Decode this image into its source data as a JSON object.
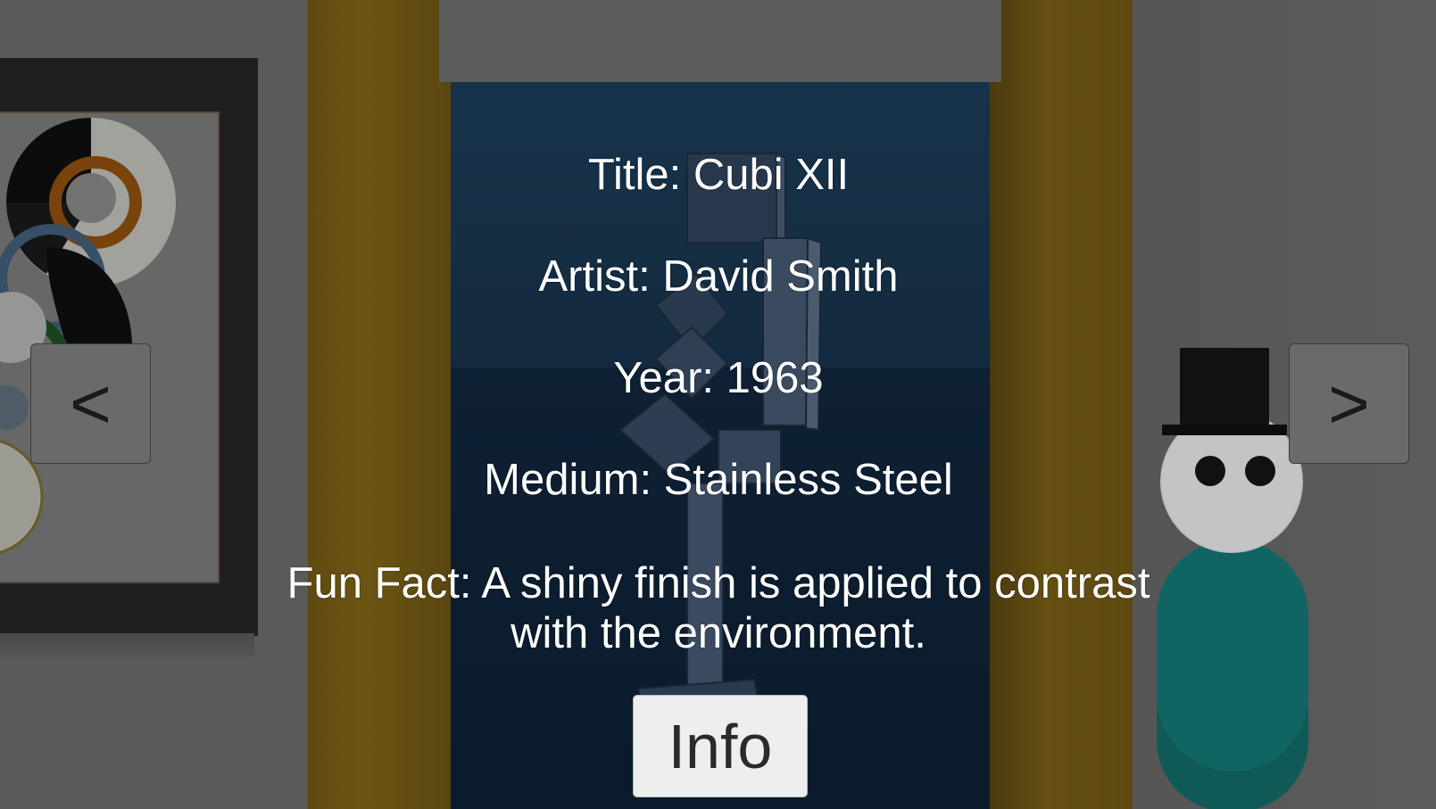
{
  "artwork": {
    "title_line": "Title: Cubi XII",
    "artist_line": "Artist: David Smith",
    "year_line": "Year: 1963",
    "medium_line": "Medium: Stainless Steel",
    "fun_fact_line": "Fun Fact: A shiny finish is applied to contrast with the environment."
  },
  "controls": {
    "prev_label": "<",
    "next_label": ">",
    "info_label": "Info"
  },
  "colors": {
    "wall": "#5a5a5a",
    "pillar": "#6b5413",
    "alcove": "#132a3f",
    "button": "#6a6a6a",
    "info_button": "#eeeeee",
    "text": "#ffffff"
  },
  "icons": {
    "figure": "snowman-with-top-hat"
  }
}
